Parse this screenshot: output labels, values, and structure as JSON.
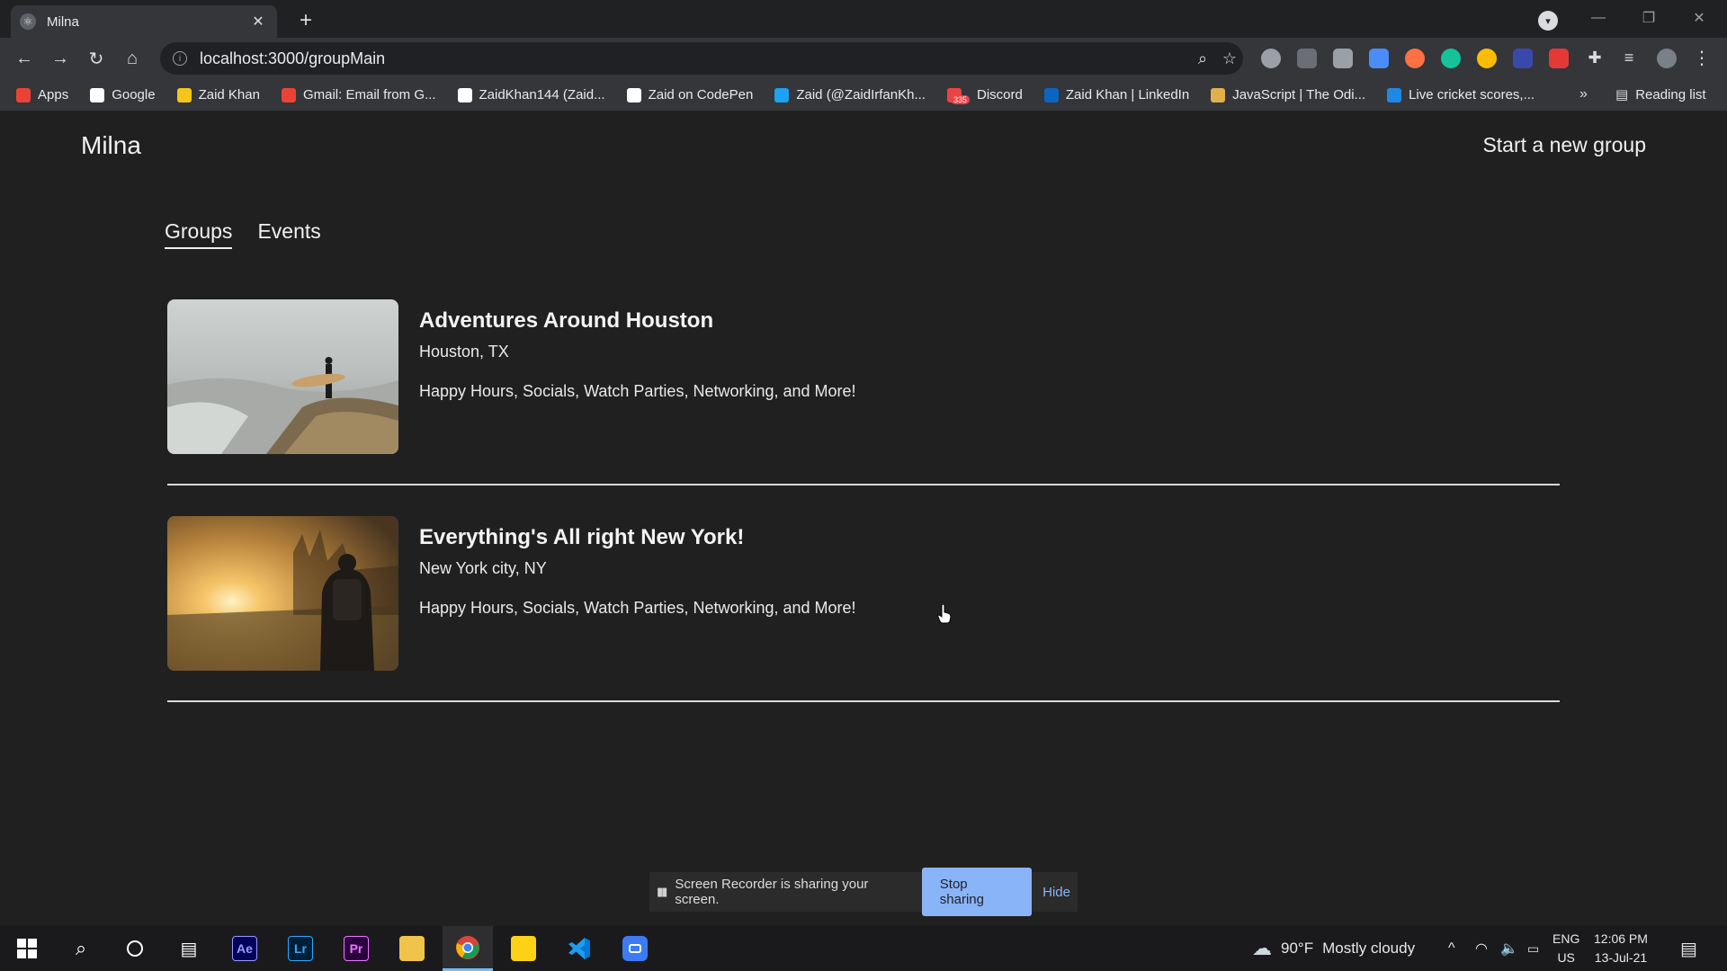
{
  "browser": {
    "tab_title": "Milna",
    "new_tab_symbol": "+",
    "url": "localhost:3000/groupMain"
  },
  "bookmarks": {
    "items": [
      {
        "label": "Apps",
        "icon": "apps-grid-icon",
        "color": "#ea4335"
      },
      {
        "label": "Google",
        "icon": "google-icon",
        "color": "#ffffff"
      },
      {
        "label": "Zaid Khan",
        "icon": "z-logo-icon",
        "color": "#f5c518"
      },
      {
        "label": "Gmail: Email from G...",
        "icon": "gmail-icon",
        "color": "#ea4335"
      },
      {
        "label": "ZaidKhan144 (Zaid...",
        "icon": "github-icon",
        "color": "#ffffff"
      },
      {
        "label": "Zaid on CodePen",
        "icon": "codepen-icon",
        "color": "#ffffff"
      },
      {
        "label": "Zaid (@ZaidIrfanKh...",
        "icon": "twitter-icon",
        "color": "#1da1f2"
      },
      {
        "label": "Discord",
        "icon": "discord-icon",
        "color": "#ed4245",
        "badge": "335"
      },
      {
        "label": "Zaid Khan | LinkedIn",
        "icon": "linkedin-icon",
        "color": "#0a66c2"
      },
      {
        "label": "JavaScript | The Odi...",
        "icon": "odin-icon",
        "color": "#e0b04a"
      },
      {
        "label": "Live cricket scores,...",
        "icon": "globe-icon",
        "color": "#1e88e5"
      }
    ],
    "more": "»",
    "reading_list": "Reading list"
  },
  "page": {
    "brand": "Milna",
    "start_group": "Start a new group",
    "tabs": [
      "Groups",
      "Events"
    ],
    "active_tab": "Groups",
    "groups": [
      {
        "title": "Adventures Around Houston",
        "location": "Houston, TX",
        "description": "Happy Hours, Socials, Watch Parties, Networking, and More!"
      },
      {
        "title": "Everything's All right New York!",
        "location": "New York city, NY",
        "description": "Happy Hours, Socials, Watch Parties, Networking, and More!"
      }
    ]
  },
  "share_bar": {
    "message": "Screen Recorder is sharing your screen.",
    "stop_label": "Stop sharing",
    "hide_label": "Hide"
  },
  "taskbar": {
    "apps": [
      {
        "label": "Ae",
        "color": "#9999ff",
        "bg": "#00005b"
      },
      {
        "label": "Lr",
        "color": "#31a8ff",
        "bg": "#001e36"
      },
      {
        "label": "Pr",
        "color": "#ea77ff",
        "bg": "#2a003f"
      }
    ],
    "weather_temp": "90°F",
    "weather_text": "Mostly cloudy",
    "lang_top": "ENG",
    "lang_bottom": "US",
    "time": "12:06 PM",
    "date": "13-Jul-21"
  }
}
